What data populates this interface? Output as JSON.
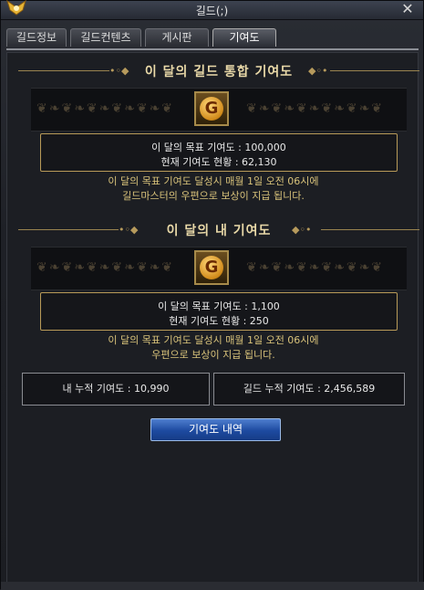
{
  "window": {
    "title": "길드(;)"
  },
  "tabs": [
    {
      "label": "길드정보"
    },
    {
      "label": "길드컨텐츠"
    },
    {
      "label": "게시판"
    },
    {
      "label": "기여도"
    }
  ],
  "guild_section": {
    "title": "이 달의 길드 통합 기여도",
    "icon_letter": "G",
    "goal_text": "이 달의 목표 기여도 : 100,000",
    "current_text": "현재 기여도 현황 : 62,130",
    "notice_line1": "이 달의 목표 기여도 달성시 매월 1일 오전 06시에",
    "notice_line2": "길드마스터의 우편으로 보상이 지급 됩니다."
  },
  "my_section": {
    "title": "이 달의 내 기여도",
    "icon_letter": "G",
    "goal_text": "이 달의 목표 기여도 : 1,100",
    "current_text": "현재 기여도 현황 : 250",
    "notice_line1": "이 달의 목표 기여도 달성시 매월 1일 오전 06시에",
    "notice_line2": "우편으로 보상이 지급 됩니다."
  },
  "totals": {
    "my_total": "내 누적 기여도 : 10,990",
    "guild_total": "길드 누적 기여도 : 2,456,589"
  },
  "history_button": {
    "label": "기여도 내역"
  },
  "colors": {
    "gold": "#b89a58",
    "accent_blue": "#1d4aa0",
    "notice": "#d8c27a"
  }
}
